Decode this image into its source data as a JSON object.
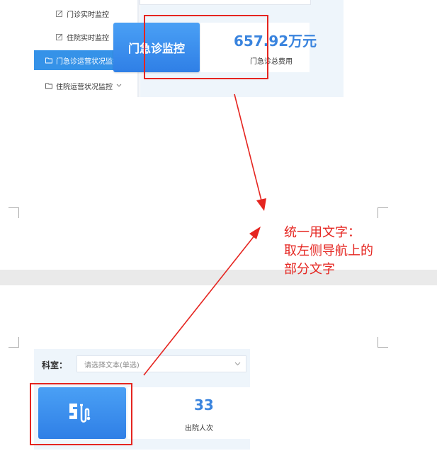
{
  "top_screenshot": {
    "sidebar": {
      "items": [
        {
          "label": "门诊实时监控",
          "icon": "edit-icon",
          "active": false
        },
        {
          "label": "住院实时监控",
          "icon": "edit-icon",
          "active": false
        },
        {
          "label": "门急诊运营状况监控",
          "icon": "folder-icon",
          "active": true
        },
        {
          "label": "住院运营状况监控",
          "icon": "folder-icon",
          "active": false
        }
      ]
    },
    "card": {
      "title": "门急诊监控",
      "value": "657.92万元",
      "value_label": "门急诊总费用"
    }
  },
  "annotation": {
    "lines": [
      "统一用文字：",
      "取左侧导航上的",
      "部分文字"
    ],
    "color": "#e52520"
  },
  "bottom_screenshot": {
    "filter": {
      "label": "科室：",
      "placeholder": "请选择文本(单选)"
    },
    "card": {
      "icon": "discharge-icon",
      "value": "33",
      "value_label": "出院人次"
    }
  }
}
